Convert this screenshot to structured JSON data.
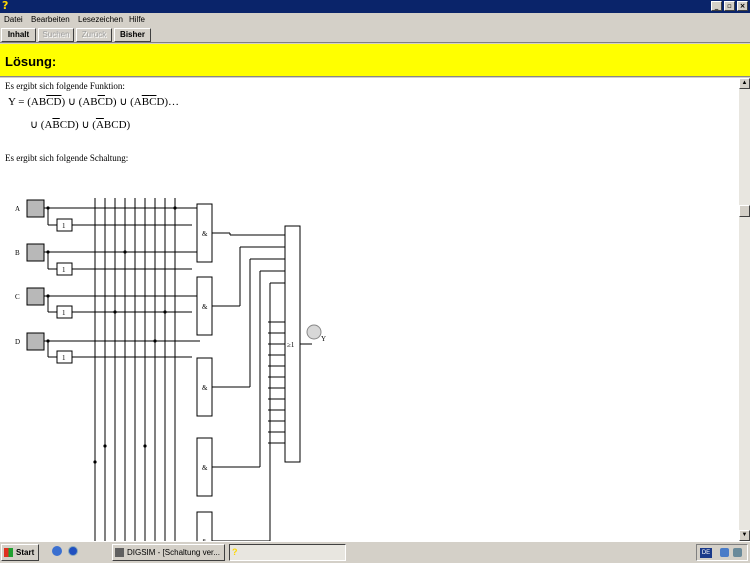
{
  "window": {
    "minimize_glyph": "_",
    "maximize_glyph": "▫",
    "close_glyph": "×"
  },
  "menu": [
    {
      "label": "Datei"
    },
    {
      "label": "Bearbeiten"
    },
    {
      "label": "Lesezeichen"
    },
    {
      "label": "Hilfe"
    }
  ],
  "nav": {
    "inhalt": "Inhalt",
    "suchen": "Suchen",
    "zurueck": "Zurück",
    "bisher": "Bisher"
  },
  "heading": "Lösung:",
  "content": {
    "intro_function": "Es ergibt sich folgende Funktion:",
    "intro_circuit": "Es ergibt sich folgende Schaltung:"
  },
  "circuit": {
    "inputs": [
      "A",
      "B",
      "C",
      "D"
    ],
    "not_label": "1",
    "and_label": "&",
    "or_label": "≥1",
    "output": "Y"
  },
  "taskbar": {
    "start": "Start",
    "task1": "DIGSIM - [Schaltung ver...",
    "tray_lang": "DE"
  }
}
